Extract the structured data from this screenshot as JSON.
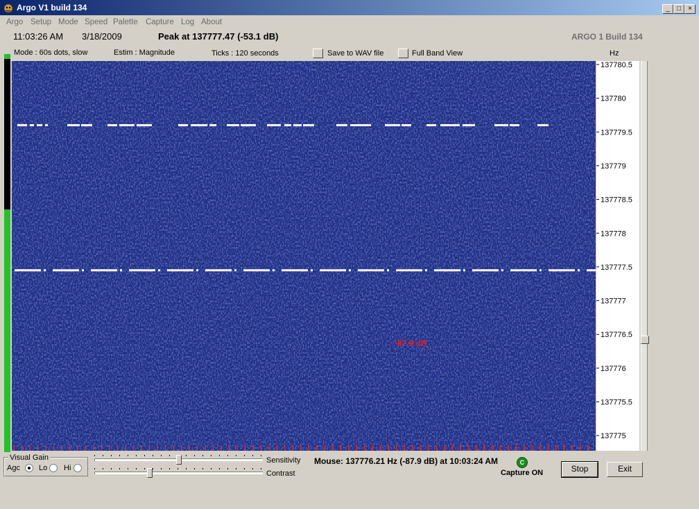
{
  "window": {
    "title": "Argo V1 build 134",
    "controls": [
      "_",
      "□",
      "×"
    ]
  },
  "menu": [
    "Argo",
    "Setup",
    "Mode",
    "Speed",
    "Palette",
    "Capture",
    "Log",
    "About"
  ],
  "status": {
    "time": "11:03:26 AM",
    "date": "3/18/2009",
    "peak": "Peak at 137777.47 (-53.1 dB)",
    "brand": "ARGO 1 Build 134"
  },
  "info": {
    "mode": "Mode : 60s dots, slow",
    "estim": "Estim : Magnitude",
    "ticks": "Ticks   : 120 seconds",
    "save_wav": "Save to WAV file",
    "full_band": "Full Band View"
  },
  "spectrogram": {
    "axis_unit": "Hz",
    "axis_labels": [
      "137780.5",
      "137780",
      "137779.5",
      "137779",
      "137778.5",
      "137778",
      "137777.5",
      "137777",
      "137776.5",
      "137776",
      "137775.5",
      "137775"
    ],
    "cursor_readout": "-87.9 dB",
    "background_color": "#1e2e86",
    "signal_color": "#ffffff",
    "signals_hz": [
      137779.6,
      137777.45
    ]
  },
  "gain": {
    "label": "Visual Gain",
    "agc": "Agc",
    "lo": "Lo",
    "hi": "Hi",
    "selected": "Agc",
    "level_fraction": 0.61
  },
  "sliders": {
    "sensitivity_label": "Sensitivity",
    "contrast_label": "Contrast",
    "sensitivity_value": 0.5,
    "contrast_value": 0.32
  },
  "mouse": {
    "readout": "Mouse:  137776.21 Hz  (-87.9 dB) at 10:03:24 AM"
  },
  "capture": {
    "indicator_letter": "C",
    "status": "Capture ON"
  },
  "buttons": {
    "stop": "Stop",
    "exit": "Exit"
  }
}
